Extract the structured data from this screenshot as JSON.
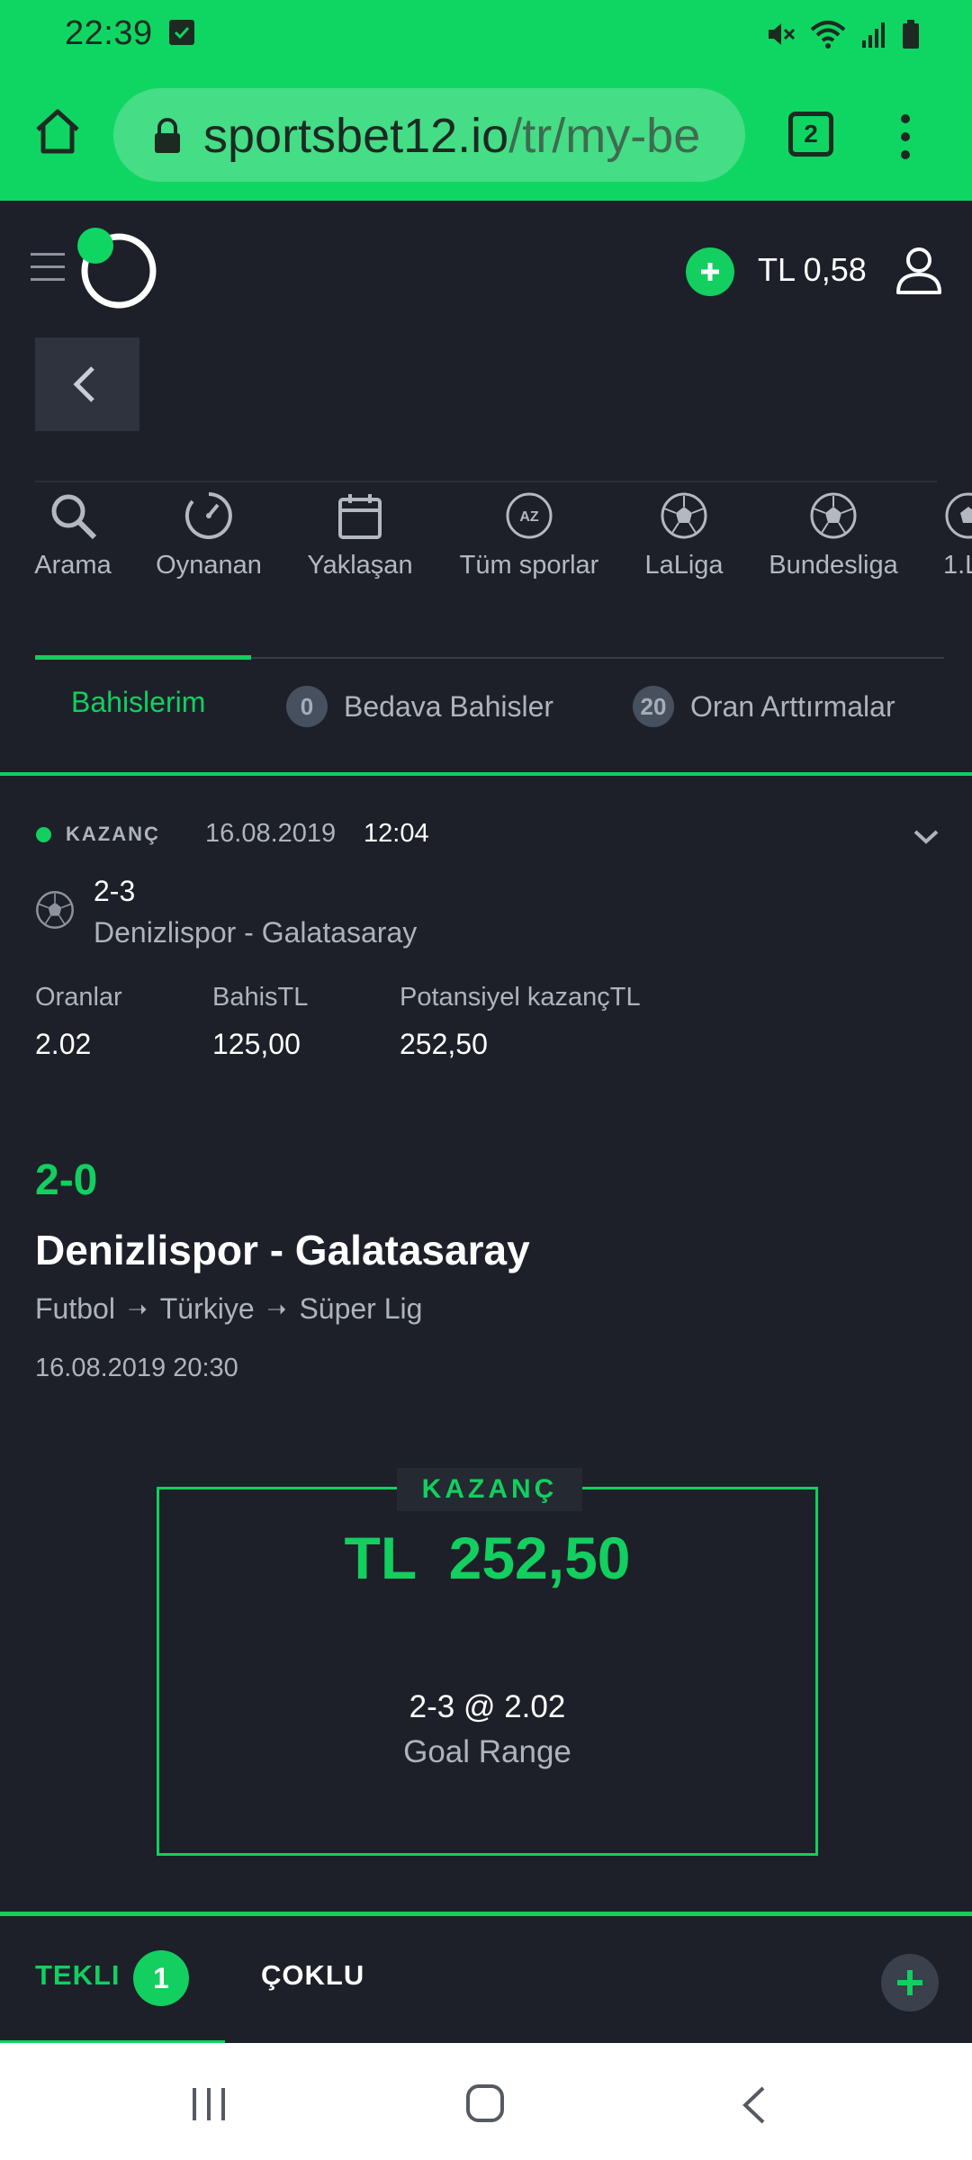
{
  "status_bar": {
    "time": "22:39",
    "icons": [
      "check-notification-icon",
      "mute-icon",
      "wifi-icon",
      "signal-icon",
      "battery-icon"
    ]
  },
  "browser": {
    "url_domain": "sportsbet12.io",
    "url_path": "/tr/my-be",
    "tab_count": "2",
    "icons": [
      "home-icon",
      "lock-icon",
      "tabs-icon",
      "menu-dots-icon"
    ]
  },
  "header": {
    "balance": "TL 0,58",
    "icons": [
      "hamburger-icon",
      "logo",
      "plus-icon",
      "user-icon"
    ]
  },
  "quick_nav": [
    {
      "label": "Arama",
      "icon": "search-icon"
    },
    {
      "label": "Oynanan",
      "icon": "gauge-icon"
    },
    {
      "label": "Yaklaşan",
      "icon": "calendar-icon"
    },
    {
      "label": "Tüm sporlar",
      "icon": "az-icon"
    },
    {
      "label": "LaLiga",
      "icon": "soccer-ball-icon"
    },
    {
      "label": "Bundesliga",
      "icon": "soccer-ball-icon"
    },
    {
      "label": "1.L",
      "icon": "soccer-ball-icon"
    }
  ],
  "tabs": [
    {
      "label": "Bahislerim",
      "count": ""
    },
    {
      "label": "Bedava Bahisler",
      "count": "0"
    },
    {
      "label": "Oran Arttırmalar",
      "count": "20"
    }
  ],
  "bet": {
    "status": "KAZANÇ",
    "date": "16.08.2019",
    "time": "12:04",
    "selection": "2-3",
    "match": "Denizlispor - Galatasaray",
    "stats": [
      {
        "label": "Oranlar",
        "value": "2.02"
      },
      {
        "label": "BahisTL",
        "value": "125,00"
      },
      {
        "label": "Potansiyel kazançTL",
        "value": "252,50"
      }
    ],
    "score": "2-0",
    "match_title": "Denizlispor - Galatasaray",
    "breadcrumb": [
      "Futbol",
      "Türkiye",
      "Süper Lig"
    ],
    "match_date": "16.08.2019 20:30",
    "result_box": {
      "tag": "KAZANÇ",
      "amount": "TL  252,50",
      "selection": "2-3 @ 2.02",
      "market": "Goal Range"
    }
  },
  "betslip": {
    "single_label": "TEKLI",
    "single_count": "1",
    "multi_label": "ÇOKLU"
  },
  "colors": {
    "accent": "#12cf5f",
    "chrome": "#0fd662",
    "background": "#1d2029",
    "muted_text": "#aeb3bc"
  }
}
